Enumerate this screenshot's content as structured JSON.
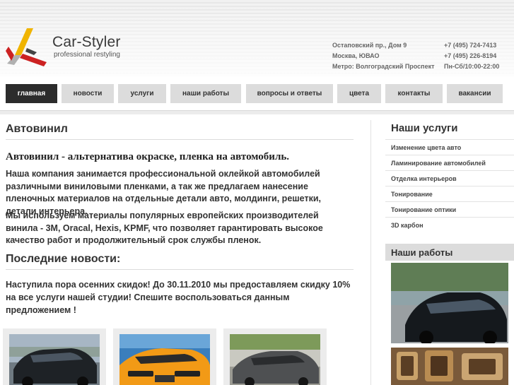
{
  "brand": {
    "name": "Car-Styler",
    "tagline": "professional restyling",
    "colors": {
      "red": "#cc2222",
      "yellow": "#f0b400",
      "dark": "#2c2c2c"
    }
  },
  "contacts": {
    "address": "Остаповский пр., Дом 9",
    "city": "Москва, ЮВАО",
    "metro": "Метро: Волгоградский Проспект",
    "phone1": "+7 (495) 724-7413",
    "phone2": "+7 (495) 226-8194",
    "hours": "Пн-Сб/10:00-22:00"
  },
  "nav": {
    "items": [
      {
        "label": "главная",
        "active": true
      },
      {
        "label": "новости"
      },
      {
        "label": "услуги"
      },
      {
        "label": "наши работы"
      },
      {
        "label": "вопросы и ответы"
      },
      {
        "label": "цвета"
      },
      {
        "label": "контакты"
      },
      {
        "label": "вакансии"
      }
    ]
  },
  "main": {
    "title": "Автовинил",
    "lead": "Автовинил - альтернатива окраске, пленка на автомобиль.",
    "paragraphs": [
      "Наша компания занимается профессиональной оклейкой автомобилей различными виниловыми пленками, а так же предлагаем нанесение пленочных материалов на отдельные детали авто, молдинги, решетки, детали интерьера.",
      "Мы используем материалы популярных европейских производителей винила - 3M, Oracal, Hexis, KPMF, что позволяет гарантировать высокое качество работ и продолжительный срок службы пленок."
    ],
    "news_title": "Последние новости:",
    "news_text": "Наступила пора осенних скидок! До 30.11.2010 мы предоставляем скидку 10% на все услуги нашей студии! Спешите воспользоваться данным предложением !"
  },
  "sidebar": {
    "services_title": "Наши услуги",
    "services": [
      "Изменение цвета авто",
      "Ламинирование автомобилей",
      "Отделка интерьеров",
      "Тонирование",
      "Тонирование оптики",
      "3D карбон"
    ],
    "works_title": "Наши работы"
  }
}
